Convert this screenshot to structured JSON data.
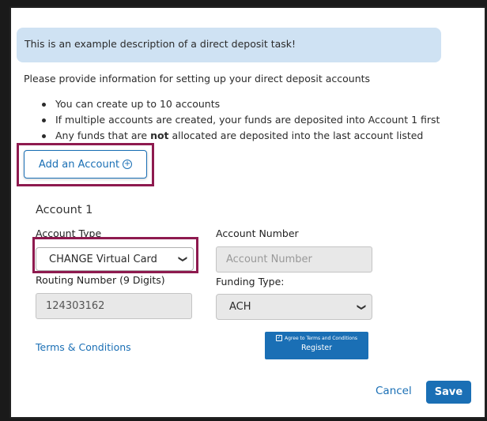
{
  "banner": {
    "text": "This is an example description of a direct deposit task!"
  },
  "intro": "Please provide information for setting up your direct deposit accounts",
  "bullets": [
    "You can create up to 10 accounts",
    "If multiple accounts are created, your funds are deposited into Account 1 first",
    {
      "pre": "Any funds that are ",
      "bold": "not",
      "post": " allocated are deposited into the last account listed"
    }
  ],
  "add_account": {
    "label": "Add an Account",
    "icon": "plus-circle-icon",
    "plus": "+"
  },
  "account": {
    "title": "Account 1",
    "account_type": {
      "label": "Account Type",
      "selected": "CHANGE Virtual Card",
      "chevron": "❯"
    },
    "account_number": {
      "label": "Account Number",
      "placeholder": "Account Number"
    },
    "routing_number": {
      "label": "Routing Number (9 Digits)",
      "value": "124303162"
    },
    "funding_type": {
      "label": "Funding Type:",
      "selected": "ACH",
      "chevron": "❯"
    }
  },
  "terms": {
    "link": "Terms & Conditions"
  },
  "register": {
    "agree": "Agree to Terms and Conditions",
    "label": "Register",
    "check": "✓"
  },
  "footer": {
    "cancel": "Cancel",
    "save": "Save"
  },
  "colors": {
    "accent": "#1a6fb5",
    "highlight": "#8e1a4f",
    "banner_bg": "#cfe2f3"
  }
}
